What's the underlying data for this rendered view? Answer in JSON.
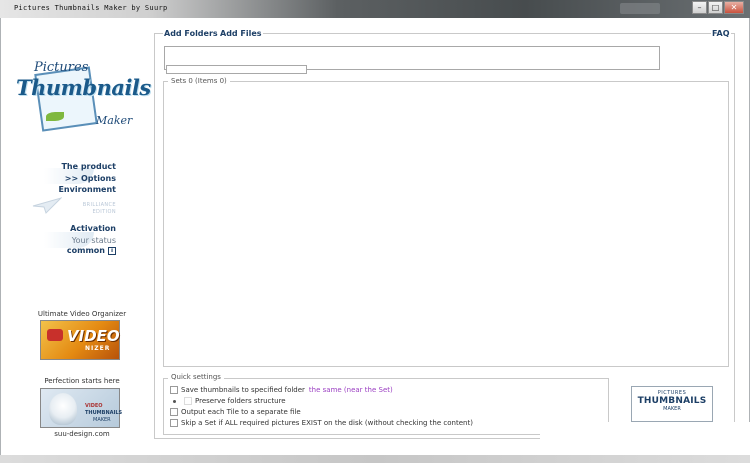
{
  "window": {
    "title": "Pictures Thumbnails Maker by Suurp",
    "controls": {
      "minimize": "–",
      "maximize": "□",
      "close": "✕"
    }
  },
  "sidebar": {
    "logo": {
      "line1": "Pictures",
      "line2": "Thumbnails",
      "line3": "Maker"
    },
    "nav": {
      "product": "The product",
      "options": ">> Options",
      "environment": "Environment",
      "edition_line1": "BRILLIANCE",
      "edition_line2": "EDITION",
      "activation": "Activation",
      "status": "Your status",
      "common": "common",
      "info_icon": "i"
    },
    "promo1": {
      "label": "Ultimate Video Organizer",
      "title": "VIDEO",
      "subtitle": "NIZER"
    },
    "promo2": {
      "label": "Perfection starts here",
      "t1": "VIDEO",
      "t2": "THUMBNAILS",
      "t3": "MAKER"
    },
    "website": "suu-design.com"
  },
  "toolbar": {
    "add_folders": "Add Folders",
    "add_files": "Add Files",
    "faq": "FAQ"
  },
  "sets": {
    "label": "Sets 0 (Items 0)"
  },
  "quick_settings": {
    "label": "Quick settings",
    "save_to_folder": "Save thumbnails to specified folder",
    "same_folder_link": "the same (near the Set)",
    "preserve_structure": "Preserve folders structure",
    "output_each_tile": "Output each Tile to a separate file",
    "skip_set": "Skip a Set if ALL required pictures EXIST on the disk (without checking the content)"
  },
  "badge": {
    "line1": "PICTURES",
    "line2": "THUMBNAILS",
    "line3": "MAKER"
  }
}
